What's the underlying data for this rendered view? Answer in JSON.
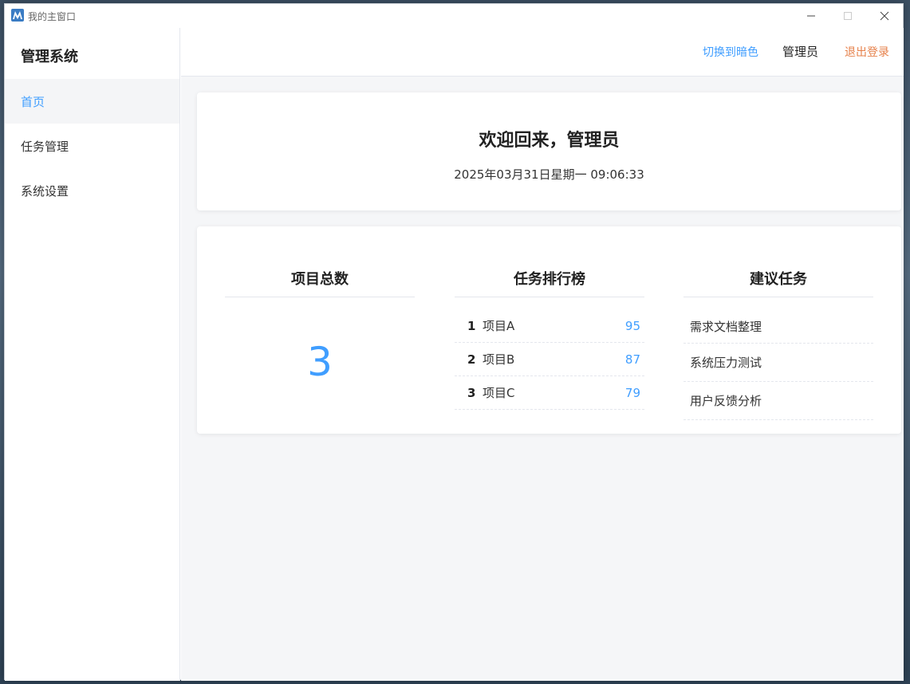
{
  "window": {
    "title": "我的主窗口",
    "icon": "app-logo-icon"
  },
  "sidebar": {
    "brand": "管理系统",
    "items": [
      {
        "label": "首页",
        "active": true
      },
      {
        "label": "任务管理",
        "active": false
      },
      {
        "label": "系统设置",
        "active": false
      }
    ]
  },
  "header": {
    "theme_toggle": "切换到暗色",
    "user": "管理员",
    "logout": "退出登录"
  },
  "welcome": {
    "title": "欢迎回来，管理员",
    "datetime": "2025年03月31日星期一 09:06:33"
  },
  "stats": {
    "project_total": {
      "title": "项目总数",
      "value": "3"
    },
    "ranking": {
      "title": "任务排行榜",
      "rows": [
        {
          "rank": "1",
          "name": "项目A",
          "score": "95"
        },
        {
          "rank": "2",
          "name": "项目B",
          "score": "87"
        },
        {
          "rank": "3",
          "name": "项目C",
          "score": "79"
        }
      ]
    },
    "suggestions": {
      "title": "建议任务",
      "items": [
        "需求文档整理",
        "系统压力测试",
        "用户反馈分析"
      ]
    }
  },
  "colors": {
    "accent": "#409eff",
    "logout": "#e6804a",
    "background": "#f5f6f8"
  }
}
